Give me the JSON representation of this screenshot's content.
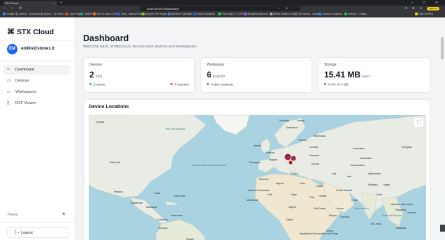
{
  "browser": {
    "tab_title": "STX Cloud",
    "tab_close": "×",
    "new_tab": "+",
    "window_controls": "– ▢ ✕",
    "nav_buttons": "‹ › ⟳",
    "url": "localhost:3000/dashboard",
    "omni_icons": "☆ ⊕ ⋯",
    "right_tools": "⊡ ⊞ ⊕",
    "profile_label": "Aggiorna",
    "bookmarks": [
      {
        "label": "Google",
        "color": "#4285f4"
      },
      {
        "label": "android - Download...",
        "color": "#6b7280"
      },
      {
        "label": "python - 3D Objec...",
        "color": "#6b7280"
      },
      {
        "label": "Login Page",
        "color": "#ef4444"
      },
      {
        "label": "ChatGPT",
        "color": "#10a37f"
      },
      {
        "label": "How to avoid CORS...",
        "color": "#f97316"
      },
      {
        "label": "Tesla - Manual Regr...",
        "color": "#2563eb"
      },
      {
        "label": "Android Tree Sugar...",
        "color": "#84cc16"
      },
      {
        "label": "Sandbox Calculator...",
        "color": "#3b82f6"
      },
      {
        "label": "Kotlin in Android",
        "color": "#2563eb"
      },
      {
        "label": "Franz.app 1.7.0 (7R...",
        "color": "#22c55e"
      },
      {
        "label": "dev.githubuser.com",
        "color": "#a855f7"
      },
      {
        "label": "Debby Android Gra...",
        "color": "#9ca3af"
      },
      {
        "label": "File Upload - Custo...",
        "color": "#6b7280"
      },
      {
        "label": "Jetpack Compose...",
        "color": "#3b82f6"
      },
      {
        "label": "Android - Coding...",
        "color": "#22c55e"
      },
      {
        "label": "Tutti i preferiti",
        "color": "#facc15"
      }
    ]
  },
  "sidebar": {
    "brand": "STX Cloud",
    "brand_icon": "⌘",
    "avatar_initials": "EM",
    "user_email": "emilio@stonex.it",
    "items": [
      {
        "label": "Dashboard",
        "icon": "⌂",
        "active": true
      },
      {
        "label": "Devices",
        "icon": "▭",
        "active": false
      },
      {
        "label": "Workspaces",
        "icon": "▱",
        "active": false
      },
      {
        "label": "DXF Viewer",
        "icon": "▯",
        "active": false
      }
    ],
    "theme_label": "Theme",
    "theme_icon": "☀",
    "logout_label": "Logout",
    "logout_icon": "[→"
  },
  "main": {
    "title": "Dashboard",
    "subtitle": "Welcome back, emilioCloud. Access your devices and workspaces.",
    "cards": [
      {
        "label": "Devices",
        "value": "2",
        "unit": "total",
        "foot_left": "2 active",
        "foot_left_color": "#22c55e",
        "foot_right": "0 inactive",
        "foot_right_color": "#ef4444"
      },
      {
        "label": "Workspace",
        "value": "6",
        "unit": "projects",
        "foot_left": "Active projects",
        "foot_left_color": "#3b82f6",
        "foot_right": "",
        "foot_right_color": ""
      },
      {
        "label": "Storage",
        "value": "15.41 MB",
        "unit": "used",
        "foot_left": "0.4% of 4 GB",
        "foot_left_color": "#3b82f6",
        "foot_right": "",
        "foot_right_color": ""
      }
    ],
    "map": {
      "title": "Device Locations",
      "fullscreen_icon": "⛶",
      "labels": [
        {
          "text": "Canada",
          "sea": false
        },
        {
          "text": "Mare del Labrador",
          "sea": true
        },
        {
          "text": "Norvegia",
          "sea": false
        },
        {
          "text": "Svezia",
          "sea": false
        },
        {
          "text": "Danimarca",
          "sea": false
        },
        {
          "text": "Bielorussia",
          "sea": false
        },
        {
          "text": "Polonia",
          "sea": false
        },
        {
          "text": "Irlanda",
          "sea": false
        },
        {
          "text": "Ucraina",
          "sea": false
        },
        {
          "text": "Kazakistan",
          "sea": false
        },
        {
          "text": "Mongolia",
          "sea": false
        },
        {
          "text": "Francia",
          "sea": false
        },
        {
          "text": "Romania",
          "sea": false
        },
        {
          "text": "Spagna",
          "sea": false
        },
        {
          "text": "Portogallo",
          "sea": false
        },
        {
          "text": "Turchia",
          "sea": false
        },
        {
          "text": "Uzbekistan",
          "sea": false
        },
        {
          "text": "Turkmenistan",
          "sea": false
        },
        {
          "text": "Stati Uniti",
          "sea": false
        },
        {
          "text": "Oceano Atlantico settentrionale",
          "sea": true
        },
        {
          "text": "Tunisia",
          "sea": false
        },
        {
          "text": "Iraq",
          "sea": false
        },
        {
          "text": "Iran",
          "sea": false
        },
        {
          "text": "Afghanistan",
          "sea": false
        },
        {
          "text": "Marocco",
          "sea": false
        },
        {
          "text": "Algeria",
          "sea": false
        },
        {
          "text": "Libia",
          "sea": false
        },
        {
          "text": "Egitto",
          "sea": false
        },
        {
          "text": "Arabia Saudita",
          "sea": false
        },
        {
          "text": "Pakistan",
          "sea": false
        },
        {
          "text": "Nepal",
          "sea": false
        },
        {
          "text": "Messico",
          "sea": false
        },
        {
          "text": "Cuba",
          "sea": false
        },
        {
          "text": "Porto Rico",
          "sea": false
        },
        {
          "text": "Sahara Occidentale",
          "sea": false
        },
        {
          "text": "Mali",
          "sea": false
        },
        {
          "text": "Niger",
          "sea": false
        },
        {
          "text": "Ciad",
          "sea": false
        },
        {
          "text": "Sudan",
          "sea": false
        },
        {
          "text": "Oman",
          "sea": false
        },
        {
          "text": "India",
          "sea": false
        },
        {
          "text": "Myanmar (Birmania)",
          "sea": false
        },
        {
          "text": "Thailandia",
          "sea": false
        },
        {
          "text": "Guatemala",
          "sea": false
        },
        {
          "text": "Nicaragua",
          "sea": false
        },
        {
          "text": "Mauritania",
          "sea": false
        },
        {
          "text": "Yemen",
          "sea": false
        },
        {
          "text": "Mare Arabico",
          "sea": true
        },
        {
          "text": "Golfo del Bengala",
          "sea": true
        },
        {
          "text": "Venezuela",
          "sea": false
        },
        {
          "text": "Colombia",
          "sea": false
        },
        {
          "text": "Nigeria",
          "sea": false
        },
        {
          "text": "Sud Sudan",
          "sea": false
        },
        {
          "text": "Etiopia",
          "sea": false
        },
        {
          "text": "Somalia",
          "sea": false
        },
        {
          "text": "Sri Lanka",
          "sea": false
        },
        {
          "text": "Vietnam",
          "sea": false
        },
        {
          "text": "Ecuador",
          "sea": false
        },
        {
          "text": "Gabon",
          "sea": false
        },
        {
          "text": "Repubblica Democratica del Congo",
          "sea": false
        },
        {
          "text": "Kenya",
          "sea": false
        },
        {
          "text": "Malaysia",
          "sea": false
        },
        {
          "text": "Brasile",
          "sea": false
        }
      ]
    }
  },
  "colors": {
    "accent": "#2563eb",
    "active_green": "#22c55e",
    "inactive_red": "#ef4444",
    "marker": "#b91c1c"
  }
}
